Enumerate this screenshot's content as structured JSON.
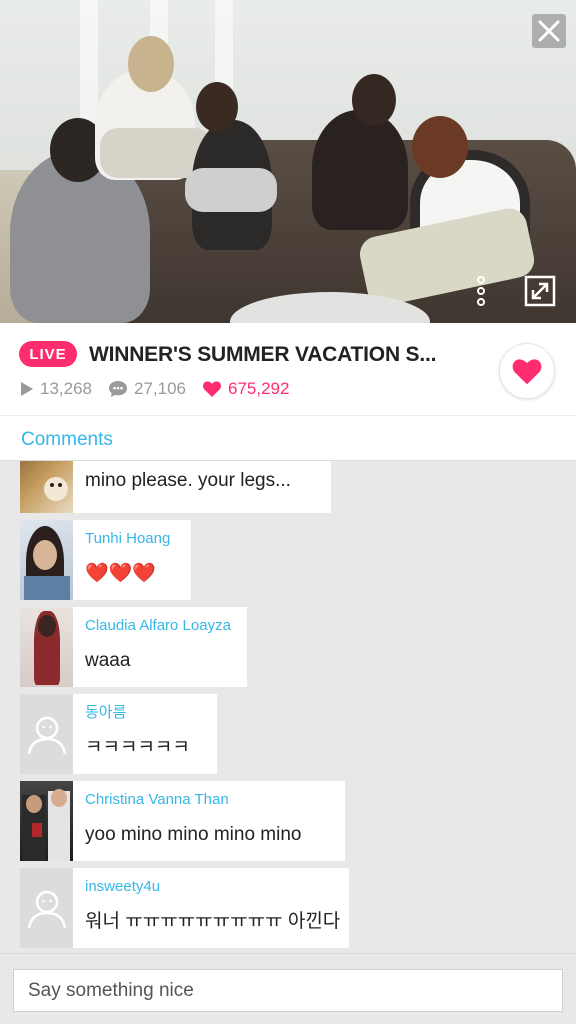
{
  "video": {
    "close_icon": "close-icon",
    "more_icon": "more-vertical-icon",
    "fullscreen_icon": "fullscreen-icon"
  },
  "broadcast": {
    "live_label": "LIVE",
    "title": "WINNER'S SUMMER VACATION S...",
    "views": "13,268",
    "comments": "27,106",
    "likes": "675,292",
    "accent_color": "#ff2d6d"
  },
  "comments_section": {
    "header": "Comments",
    "header_color": "#36b7e8",
    "items": [
      {
        "name": "",
        "text": "mino please. your legs...",
        "avatar": "photo-avatar"
      },
      {
        "name": "Tunhi Hoang",
        "text": "❤️❤️❤️",
        "avatar": "photo-avatar"
      },
      {
        "name": "Claudia Alfaro Loayza",
        "text": "waaa",
        "avatar": "photo-avatar"
      },
      {
        "name": "동아름",
        "text": "ㅋㅋㅋㅋㅋㅋ",
        "avatar": "default-avatar"
      },
      {
        "name": "Christina Vanna Than",
        "text": "yoo mino mino mino mino",
        "avatar": "photo-avatar"
      },
      {
        "name": "insweety4u",
        "text": "워너 ㅠㅠㅠㅠㅠㅠㅠㅠㅠ 아낀다",
        "avatar": "default-avatar"
      }
    ]
  },
  "input": {
    "placeholder": "Say something nice"
  }
}
